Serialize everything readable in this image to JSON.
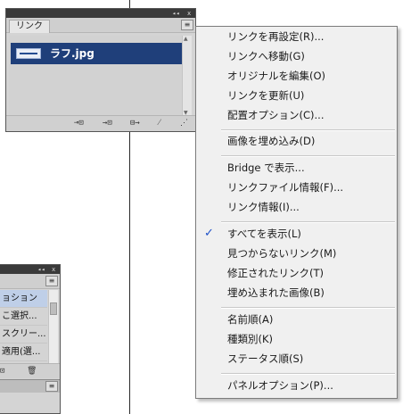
{
  "links_panel": {
    "title": "リンク",
    "items": [
      {
        "name": "ラフ.jpg"
      }
    ]
  },
  "second_panel": {
    "items": [
      "ョション",
      "こ選択...",
      "スクリー...",
      "適用(選..."
    ]
  },
  "context_menu": {
    "items": [
      {
        "label": "リンクを再設定(R)...",
        "checked": false
      },
      {
        "label": "リンクへ移動(G)",
        "checked": false
      },
      {
        "label": "オリジナルを編集(O)",
        "checked": false
      },
      {
        "label": "リンクを更新(U)",
        "checked": false
      },
      {
        "label": "配置オプション(C)...",
        "checked": false
      },
      {
        "label": "画像を埋め込み(D)",
        "checked": false
      },
      {
        "label": "Bridge で表示...",
        "checked": false
      },
      {
        "label": "リンクファイル情報(F)...",
        "checked": false
      },
      {
        "label": "リンク情報(I)...",
        "checked": false
      },
      {
        "label": "すべてを表示(L)",
        "checked": true
      },
      {
        "label": "見つからないリンク(M)",
        "checked": false
      },
      {
        "label": "修正されたリンク(T)",
        "checked": false
      },
      {
        "label": "埋め込まれた画像(B)",
        "checked": false
      },
      {
        "label": "名前順(A)",
        "checked": false
      },
      {
        "label": "種類別(K)",
        "checked": false
      },
      {
        "label": "ステータス順(S)",
        "checked": false
      },
      {
        "label": "パネルオプション(P)...",
        "checked": false
      }
    ]
  },
  "colors": {
    "selection": "#1f3f7a",
    "check": "#1e50c8"
  }
}
